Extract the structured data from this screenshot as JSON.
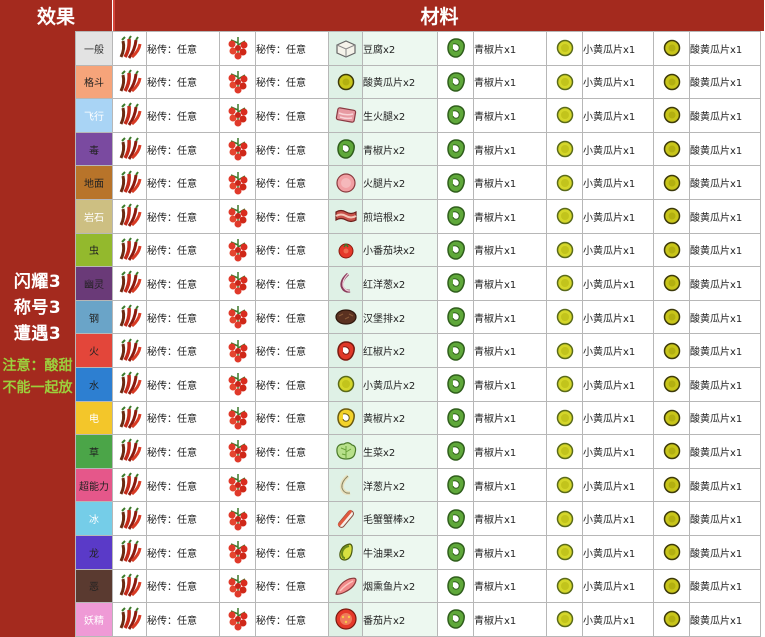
{
  "header": {
    "effect_label": "效果",
    "materials_label": "材料"
  },
  "effect": {
    "lines": [
      "闪耀3",
      "称号3",
      "遭遇3"
    ],
    "note": "注意：酸甜不能一起放"
  },
  "slot_text": "秘传：任意",
  "green_pepper_text": "青椒片x1",
  "cucumber_text": "小黄瓜片x1",
  "pickle_text": "酸黄瓜片x1",
  "rows": [
    {
      "type": "一般",
      "color": "#e3e3e3",
      "ingredient": "豆腐x2",
      "icon": "tofu-icon"
    },
    {
      "type": "格斗",
      "color": "#f6a47a",
      "ingredient": "酸黄瓜片x2",
      "icon": "pickle-icon"
    },
    {
      "type": "飞行",
      "color": "#a9d4f5",
      "ingredient": "生火腿x2",
      "icon": "prosciutto-icon"
    },
    {
      "type": "毒",
      "color": "#7a4aa0",
      "ingredient": "青椒片x2",
      "icon": "green-pepper-icon"
    },
    {
      "type": "地面",
      "color": "#b8742a",
      "ingredient": "火腿片x2",
      "icon": "ham-icon"
    },
    {
      "type": "岩石",
      "color": "#cdbf82",
      "ingredient": "煎培根x2",
      "icon": "bacon-icon"
    },
    {
      "type": "虫",
      "color": "#93b92d",
      "ingredient": "小番茄块x2",
      "icon": "cherry-tomato-icon"
    },
    {
      "type": "幽灵",
      "color": "#6a3a78",
      "ingredient": "红洋葱x2",
      "icon": "red-onion-icon"
    },
    {
      "type": "钢",
      "color": "#6aa4c8",
      "ingredient": "汉堡排x2",
      "icon": "hamburger-patty-icon"
    },
    {
      "type": "火",
      "color": "#e3463a",
      "ingredient": "红椒片x2",
      "icon": "red-pepper-icon"
    },
    {
      "type": "水",
      "color": "#2d7fd1",
      "ingredient": "小黄瓜片x2",
      "icon": "cucumber-icon"
    },
    {
      "type": "电",
      "color": "#f3c62a",
      "ingredient": "黄椒片x2",
      "icon": "yellow-pepper-icon"
    },
    {
      "type": "草",
      "color": "#4ba548",
      "ingredient": "生菜x2",
      "icon": "lettuce-icon"
    },
    {
      "type": "超能力",
      "color": "#e5578a",
      "ingredient": "洋葱片x2",
      "icon": "onion-icon"
    },
    {
      "type": "冰",
      "color": "#75cde8",
      "ingredient": "毛蟹蟹棒x2",
      "icon": "crab-stick-icon"
    },
    {
      "type": "龙",
      "color": "#5a3ac8",
      "ingredient": "牛油果x2",
      "icon": "avocado-icon"
    },
    {
      "type": "恶",
      "color": "#5a3a30",
      "ingredient": "烟熏鱼片x2",
      "icon": "smoked-fillet-icon"
    },
    {
      "type": "妖精",
      "color": "#ef9ad6",
      "ingredient": "番茄片x2",
      "icon": "tomato-slice-icon"
    }
  ],
  "colors": {
    "header_red": "#a42a1e",
    "note_green": "#9ccf3c",
    "link_blue": "#3b6fb5",
    "ingredient_bg": "#edf8f0"
  }
}
